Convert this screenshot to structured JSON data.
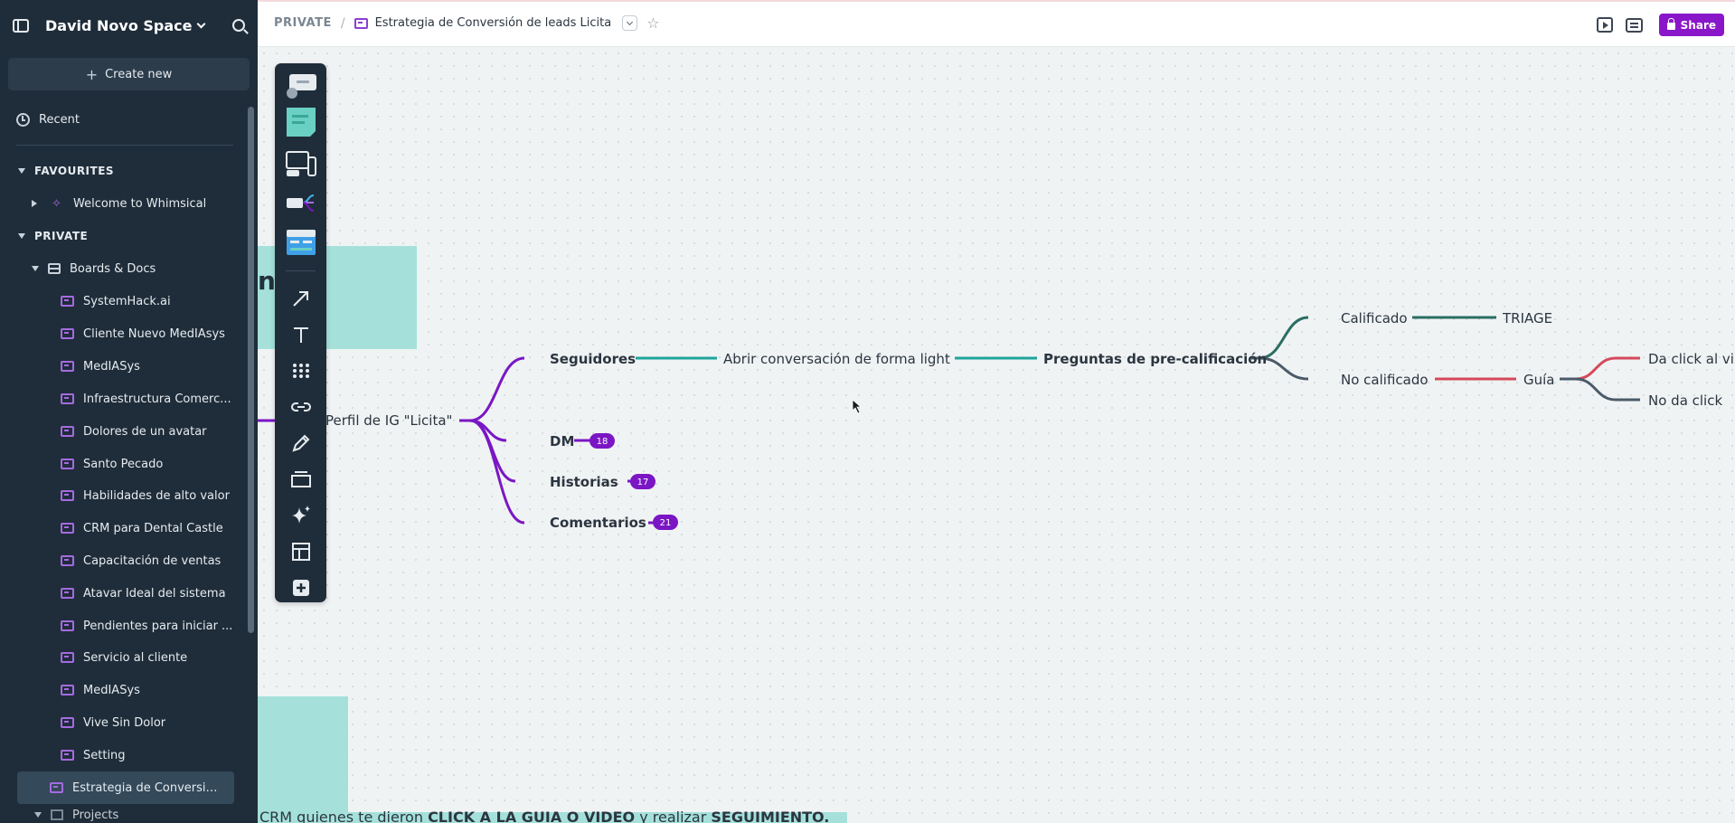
{
  "sidebar": {
    "space_name": "David Novo Space",
    "create_label": "Create new",
    "recent_label": "Recent",
    "favourites_label": "FAVOURITES",
    "welcome_label": "Welcome to Whimsical",
    "private_label": "PRIVATE",
    "boards_docs_label": "Boards & Docs",
    "items": [
      {
        "label": "SystemHack.ai"
      },
      {
        "label": "Cliente Nuevo MedIAsys"
      },
      {
        "label": "MedIASys"
      },
      {
        "label": "Infraestructura Comerc..."
      },
      {
        "label": "Dolores de un avatar"
      },
      {
        "label": "Santo Pecado"
      },
      {
        "label": "Habilidades de alto valor"
      },
      {
        "label": "CRM para Dental Castle"
      },
      {
        "label": "Capacitación de ventas"
      },
      {
        "label": "Atavar Ideal del sistema"
      },
      {
        "label": "Pendientes para iniciar ..."
      },
      {
        "label": "Servicio al cliente"
      },
      {
        "label": "MedIASys"
      },
      {
        "label": "Vive Sin Dolor"
      },
      {
        "label": "Setting"
      },
      {
        "label": "Estrategia de Conversió..."
      }
    ],
    "projects_label": "Projects"
  },
  "header": {
    "crumb_private": "PRIVATE",
    "crumb_sep": "/",
    "doc_title": "Estrategia de Conversión de leads Licita",
    "share_label": "Share"
  },
  "canvas": {
    "partial_heading": "n",
    "bottom_text_parts": [
      "CRM quienes te dieron ",
      "CLICK A LA GUIA O VIDEO",
      " y realizar ",
      "SEGUIMIENTO."
    ],
    "root": "Perfil de IG  \"Licita\"",
    "branches": {
      "seguidores": "Seguidores",
      "dm": "DM",
      "historias": "Historias",
      "comentarios": "Comentarios"
    },
    "badges": {
      "dm": "18",
      "historias": "17",
      "comentarios": "21"
    },
    "abrir": "Abrir conversación de forma light",
    "preguntas": "Preguntas de pre-calificación",
    "calificado": "Calificado",
    "triage": "TRIAGE",
    "no_calificado": "No calificado",
    "guia": "Guía",
    "da_click": "Da click al vi",
    "no_da_click": "No da click"
  },
  "colors": {
    "purple": "#7b16c4",
    "teal": "#1fa59b",
    "dark_green": "#2a6e63",
    "slate": "#4a5a68",
    "red": "#d4495a",
    "sticky": "#a5e1da",
    "share": "#8a16c9"
  },
  "toolbar": {
    "tools": [
      "comment-card-tool",
      "sticky-note-tool",
      "wireframe-tool",
      "mindmap-tool",
      "doc-card-tool",
      "arrow-tool",
      "text-tool",
      "grid-tool",
      "link-tool",
      "pen-tool",
      "section-tool",
      "ai-tool",
      "table-tool",
      "add-tool"
    ]
  }
}
